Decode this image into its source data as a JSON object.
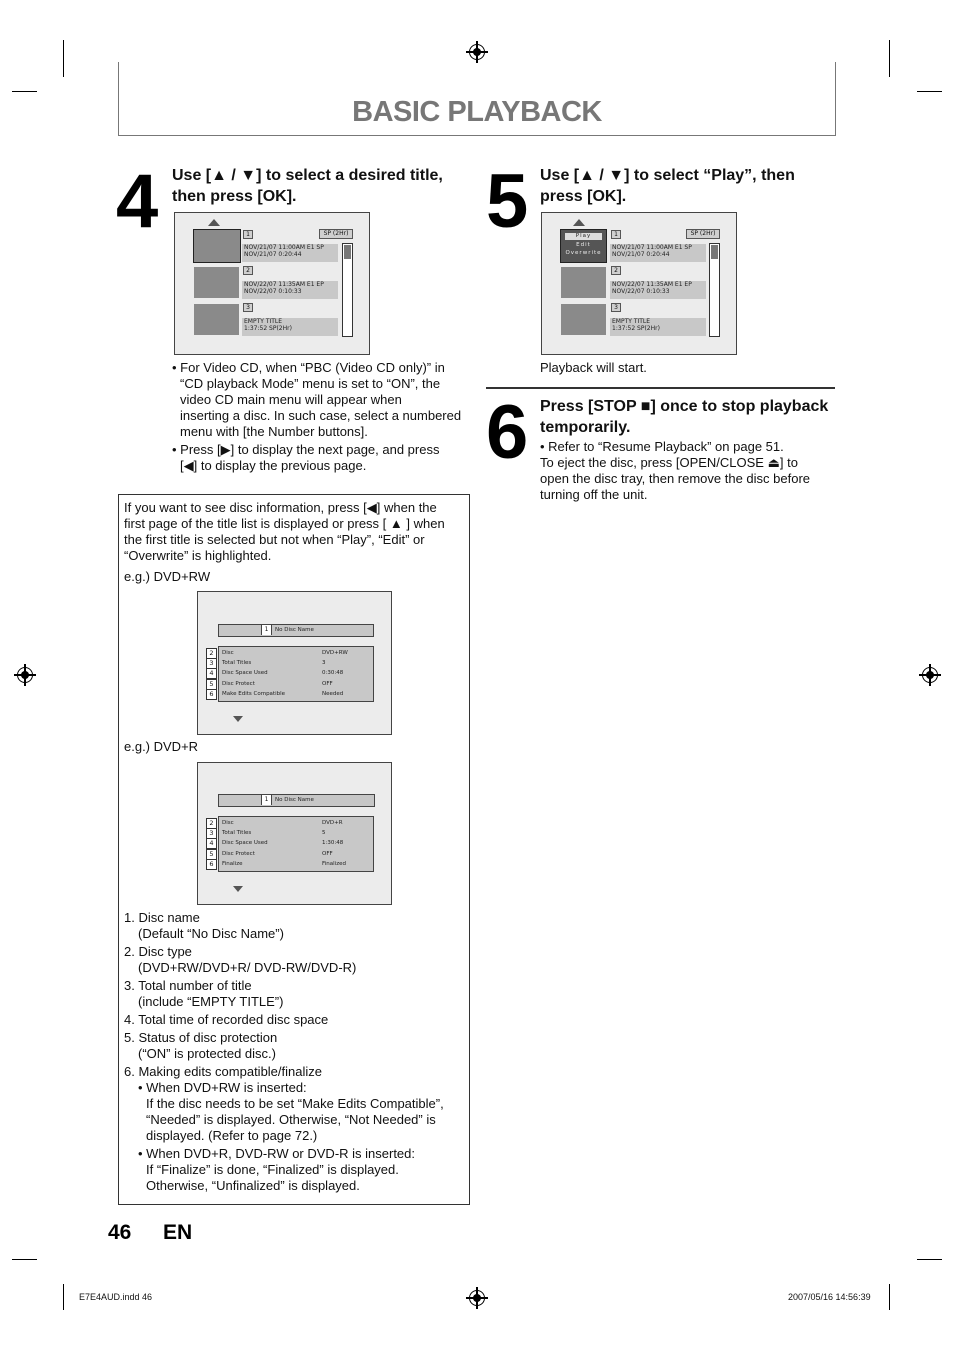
{
  "page": {
    "section_title": "BASIC PLAYBACK",
    "page_number": "46",
    "language": "EN",
    "footer_file": "E7E4AUD.indd   46",
    "footer_date": "2007/05/16   14:56:39"
  },
  "step4": {
    "number": "4",
    "heading_line1": "Use [▲ / ▼] to select a desired title,",
    "heading_line2": "then press [OK].",
    "bullets": [
      [
        "• For Video CD, when “PBC (Video CD only)” in",
        "“CD playback Mode” menu is set to “ON”, the",
        "video CD main menu will appear when",
        "inserting a disc. In such case, select a numbered",
        "menu with [the Number buttons]."
      ],
      [
        "• Press [▶] to display the next page, and press",
        "[◀] to display the previous page."
      ]
    ]
  },
  "title_list_screen": {
    "sp_tag": "SP (2Hr)",
    "items": [
      {
        "num": "1",
        "line1": "NOV/21/07  11:00AM  E1  SP",
        "line2": "NOV/21/07    0:20:44"
      },
      {
        "num": "2",
        "line1": "NOV/22/07  11:35AM  E1  EP",
        "line2": "NOV/22/07    0:10:33"
      },
      {
        "num": "3",
        "line1": "EMPTY TITLE",
        "line2": "1:37:52  SP(2Hr)"
      }
    ],
    "menu": [
      "Play",
      "Edit",
      "Overwrite"
    ]
  },
  "step5": {
    "number": "5",
    "heading_line1": "Use [▲ / ▼] to select “Play”, then",
    "heading_line2": "press [OK].",
    "note": "Playback will start."
  },
  "step6": {
    "number": "6",
    "heading_line1": "Press [STOP ■] once to stop playback",
    "heading_line2": "temporarily.",
    "lines": [
      "• Refer to “Resume Playback” on page 51.",
      "To eject the disc, press [OPEN/CLOSE ⏏] to",
      "open the disc tray, then remove the disc before",
      "turning off the unit."
    ]
  },
  "info_box": {
    "intro": [
      "If you want to see disc information, press [◀] when the",
      "first page of the title list is displayed or press [ ▲ ] when",
      "the first title is selected but not when “Play”, “Edit” or",
      "“Overwrite” is highlighted."
    ],
    "example1_label": "e.g.) DVD+RW",
    "example2_label": "e.g.) DVD+R",
    "disc1": {
      "name_num": "1",
      "name": "No Disc Name",
      "side_nums": [
        "2",
        "3",
        "4",
        "5",
        "6"
      ],
      "rows": [
        {
          "label": "Disc",
          "value": "DVD+RW"
        },
        {
          "label": "Total Titles",
          "value": "3"
        },
        {
          "label": "Disc Space Used",
          "value": "0:30:48"
        },
        {
          "label": "Disc Protect",
          "value": "OFF"
        },
        {
          "label": "Make Edits Compatible",
          "value": "Needed"
        }
      ]
    },
    "disc2": {
      "name_num": "1",
      "name": "No Disc Name",
      "side_nums": [
        "2",
        "3",
        "4",
        "5",
        "6"
      ],
      "rows": [
        {
          "label": "Disc",
          "value": "DVD+R"
        },
        {
          "label": "Total Titles",
          "value": "5"
        },
        {
          "label": "Disc Space Used",
          "value": "1:30:48"
        },
        {
          "label": "Disc Protect",
          "value": "OFF"
        },
        {
          "label": "Finalize",
          "value": "Finalized"
        }
      ]
    },
    "legend": [
      "1. Disc name",
      "(Default “No Disc Name”)",
      "2. Disc type",
      "(DVD+RW/DVD+R/ DVD-RW/DVD-R)",
      "3. Total number of title",
      "(include “EMPTY TITLE”)",
      "4. Total time of recorded disc space",
      "5. Status of disc protection",
      "(“ON” is protected disc.)",
      "6. Making edits compatible/finalize",
      "• When DVD+RW is inserted:",
      "If the disc needs to be set “Make Edits Compatible”,",
      "“Needed” is displayed. Otherwise, “Not Needed” is",
      "displayed. (Refer to page 72.)",
      "• When DVD+R, DVD-RW or DVD-R is inserted:",
      "If “Finalize” is done, “Finalized”  is displayed.",
      "Otherwise, “Unfinalized” is displayed."
    ]
  }
}
